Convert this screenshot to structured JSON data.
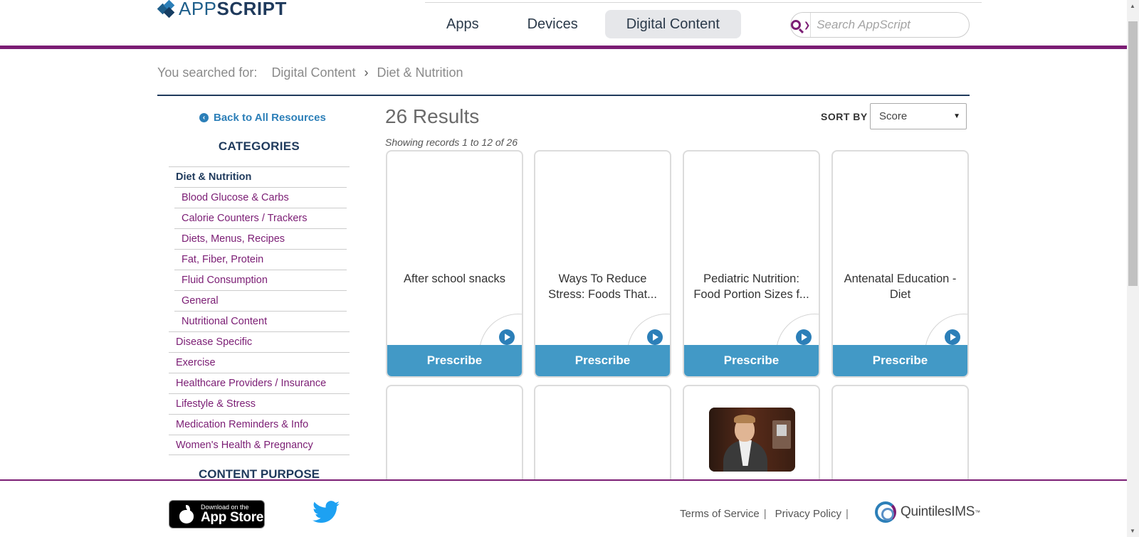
{
  "header": {
    "logo_prefix": "APP",
    "logo_suffix": "SCRIPT",
    "nav": [
      {
        "label": "Apps"
      },
      {
        "label": "Devices"
      },
      {
        "label": "Digital Content",
        "active": true
      }
    ],
    "search_placeholder": "Search AppScript",
    "search_dropdown_icon": "chevron-down-icon"
  },
  "breadcrumb": {
    "prefix": "You searched for:",
    "items": [
      "Digital Content",
      "Diet & Nutrition"
    ],
    "separator": "›"
  },
  "sidebar": {
    "back_label": "Back to All Resources",
    "categories_title": "CATEGORIES",
    "categories": [
      {
        "label": "Diet & Nutrition",
        "type": "parent-active"
      },
      {
        "label": "Blood Glucose & Carbs",
        "type": "sub"
      },
      {
        "label": "Calorie Counters / Trackers",
        "type": "sub"
      },
      {
        "label": "Diets, Menus, Recipes",
        "type": "sub"
      },
      {
        "label": "Fat, Fiber, Protein",
        "type": "sub"
      },
      {
        "label": "Fluid Consumption",
        "type": "sub"
      },
      {
        "label": "General",
        "type": "sub"
      },
      {
        "label": "Nutritional Content",
        "type": "sub"
      },
      {
        "label": "Disease Specific",
        "type": "top"
      },
      {
        "label": "Exercise",
        "type": "top"
      },
      {
        "label": "Healthcare Providers / Insurance",
        "type": "top"
      },
      {
        "label": "Lifestyle & Stress",
        "type": "top"
      },
      {
        "label": "Medication Reminders & Info",
        "type": "top"
      },
      {
        "label": "Women's Health & Pregnancy",
        "type": "top"
      }
    ],
    "purpose_title": "CONTENT PURPOSE"
  },
  "results": {
    "count_label": "26 Results",
    "records_label": "Showing records 1 to 12 of 26",
    "sort_label": "SORT BY",
    "sort_value": "Score",
    "cards_row1": [
      {
        "title": "After school snacks",
        "button": "Prescribe"
      },
      {
        "title": "Ways To Reduce Stress: Foods That...",
        "button": "Prescribe"
      },
      {
        "title": "Pediatric Nutrition: Food Portion Sizes f...",
        "button": "Prescribe"
      },
      {
        "title": "Antenatal Education - Diet",
        "button": "Prescribe"
      }
    ]
  },
  "footer": {
    "appstore_small": "Download on the",
    "appstore_big": "App Store",
    "terms": "Terms of Service",
    "privacy": "Privacy Policy",
    "divider": "|",
    "brand": "QuintilesIMS",
    "brand_tm": "™"
  },
  "colors": {
    "brand_purple": "#7b1d74",
    "brand_navy": "#1f3a5c",
    "accent_blue": "#4299c6",
    "link_blue": "#2c7fb8"
  }
}
